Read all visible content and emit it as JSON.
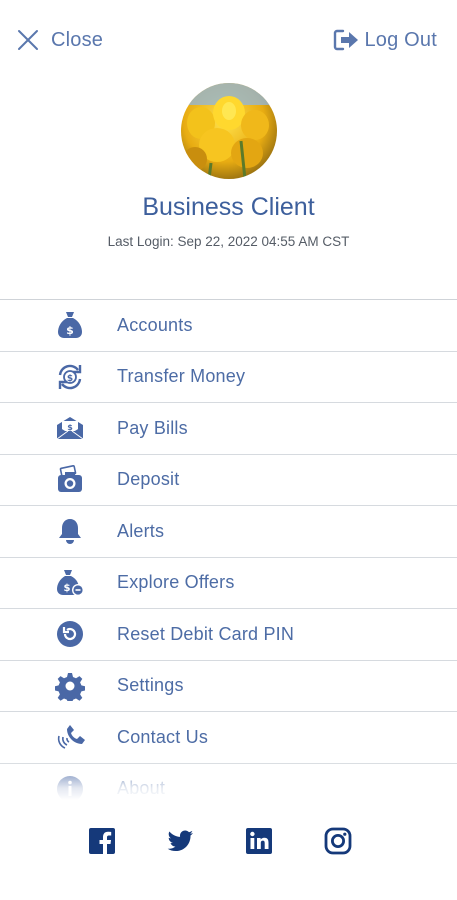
{
  "header": {
    "close_label": "Close",
    "logout_label": "Log Out"
  },
  "profile": {
    "name": "Business Client",
    "last_login": "Last Login: Sep 22, 2022 04:55 AM CST"
  },
  "menu": {
    "items": [
      {
        "label": "Accounts",
        "icon": "money-bag-icon"
      },
      {
        "label": "Transfer Money",
        "icon": "transfer-icon"
      },
      {
        "label": "Pay Bills",
        "icon": "envelope-money-icon"
      },
      {
        "label": "Deposit",
        "icon": "camera-check-icon"
      },
      {
        "label": "Alerts",
        "icon": "bell-icon"
      },
      {
        "label": "Explore Offers",
        "icon": "money-bag-offer-icon"
      },
      {
        "label": "Reset Debit Card PIN",
        "icon": "reset-icon"
      },
      {
        "label": "Settings",
        "icon": "gear-icon"
      },
      {
        "label": "Contact Us",
        "icon": "phone-icon"
      },
      {
        "label": "About",
        "icon": "info-icon"
      }
    ]
  },
  "social": [
    "facebook-icon",
    "twitter-icon",
    "linkedin-icon",
    "instagram-icon"
  ],
  "colors": {
    "brand": "#3d5f9c",
    "icon": "#4a68a6",
    "social": "#15397a",
    "divider": "#d6dadf"
  }
}
